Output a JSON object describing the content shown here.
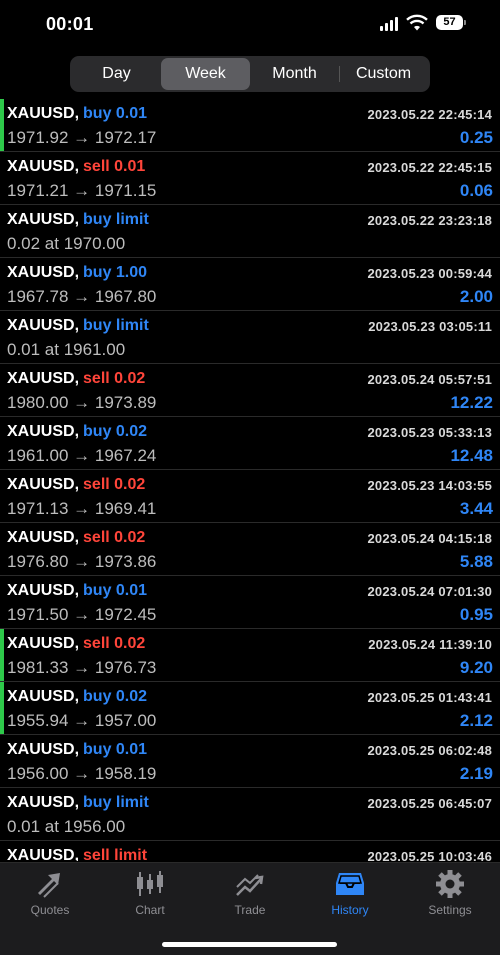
{
  "status": {
    "time": "00:01",
    "battery": "57"
  },
  "segments": {
    "day": "Day",
    "week": "Week",
    "month": "Month",
    "custom": "Custom",
    "active": "Week"
  },
  "orders": [
    {
      "symbol": "XAUUSD,",
      "type": "buy",
      "action": "buy 0.01",
      "date": "2023.05.22 22:45:14",
      "prices": "1971.92 → 1972.17",
      "profit": "0.25",
      "marked": true
    },
    {
      "symbol": "XAUUSD,",
      "type": "sell",
      "action": "sell 0.01",
      "date": "2023.05.22 22:45:15",
      "prices": "1971.21 → 1971.15",
      "profit": "0.06",
      "marked": false
    },
    {
      "symbol": "XAUUSD,",
      "type": "buy",
      "action": "buy limit",
      "date": "2023.05.22 23:23:18",
      "prices": "0.02 at 1970.00",
      "profit": "",
      "marked": false
    },
    {
      "symbol": "XAUUSD,",
      "type": "buy",
      "action": "buy 1.00",
      "date": "2023.05.23 00:59:44",
      "prices": "1967.78 → 1967.80",
      "profit": "2.00",
      "marked": false
    },
    {
      "symbol": "XAUUSD,",
      "type": "buy",
      "action": "buy limit",
      "date": "2023.05.23 03:05:11",
      "prices": "0.01 at 1961.00",
      "profit": "",
      "marked": false
    },
    {
      "symbol": "XAUUSD,",
      "type": "sell",
      "action": "sell 0.02",
      "date": "2023.05.24 05:57:51",
      "prices": "1980.00 → 1973.89",
      "profit": "12.22",
      "marked": false
    },
    {
      "symbol": "XAUUSD,",
      "type": "buy",
      "action": "buy 0.02",
      "date": "2023.05.23 05:33:13",
      "prices": "1961.00 → 1967.24",
      "profit": "12.48",
      "marked": false
    },
    {
      "symbol": "XAUUSD,",
      "type": "sell",
      "action": "sell 0.02",
      "date": "2023.05.23 14:03:55",
      "prices": "1971.13 → 1969.41",
      "profit": "3.44",
      "marked": false
    },
    {
      "symbol": "XAUUSD,",
      "type": "sell",
      "action": "sell 0.02",
      "date": "2023.05.24 04:15:18",
      "prices": "1976.80 → 1973.86",
      "profit": "5.88",
      "marked": false
    },
    {
      "symbol": "XAUUSD,",
      "type": "buy",
      "action": "buy 0.01",
      "date": "2023.05.24 07:01:30",
      "prices": "1971.50 → 1972.45",
      "profit": "0.95",
      "marked": false
    },
    {
      "symbol": "XAUUSD,",
      "type": "sell",
      "action": "sell 0.02",
      "date": "2023.05.24 11:39:10",
      "prices": "1981.33 → 1976.73",
      "profit": "9.20",
      "marked": true
    },
    {
      "symbol": "XAUUSD,",
      "type": "buy",
      "action": "buy 0.02",
      "date": "2023.05.25 01:43:41",
      "prices": "1955.94 → 1957.00",
      "profit": "2.12",
      "marked": true
    },
    {
      "symbol": "XAUUSD,",
      "type": "buy",
      "action": "buy 0.01",
      "date": "2023.05.25 06:02:48",
      "prices": "1956.00 → 1958.19",
      "profit": "2.19",
      "marked": false
    },
    {
      "symbol": "XAUUSD,",
      "type": "buy",
      "action": "buy limit",
      "date": "2023.05.25 06:45:07",
      "prices": "0.01 at 1956.00",
      "profit": "",
      "marked": false
    },
    {
      "symbol": "XAUUSD,",
      "type": "sell",
      "action": "sell limit",
      "date": "2023.05.25 10:03:46",
      "prices": "",
      "profit": "",
      "marked": false
    }
  ],
  "tabs": [
    {
      "label": "Quotes",
      "icon": "quotes-icon"
    },
    {
      "label": "Chart",
      "icon": "chart-icon"
    },
    {
      "label": "Trade",
      "icon": "trade-icon"
    },
    {
      "label": "History",
      "icon": "history-icon",
      "active": true
    },
    {
      "label": "Settings",
      "icon": "settings-icon"
    }
  ]
}
